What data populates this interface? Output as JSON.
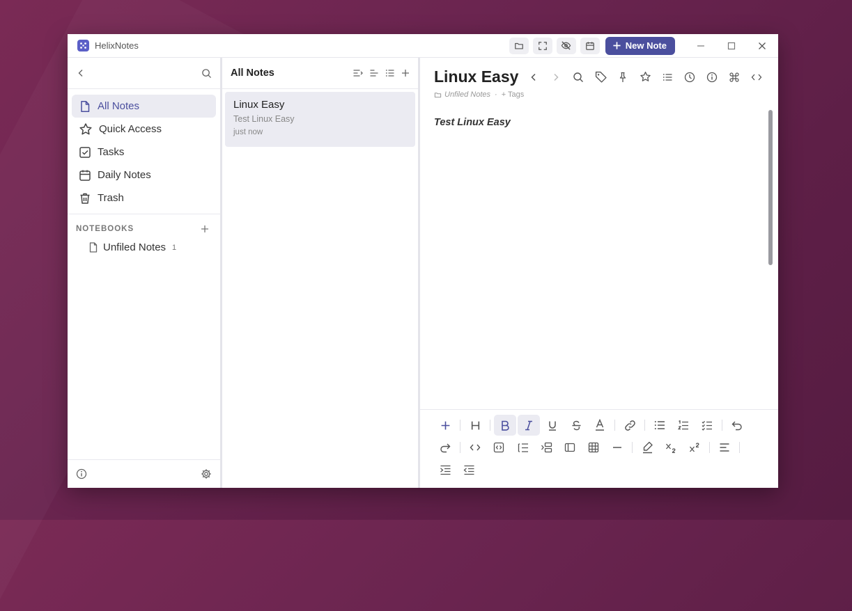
{
  "app": {
    "title": "HelixNotes",
    "new_note_label": "New Note"
  },
  "sidebar": {
    "items": [
      {
        "label": "All Notes",
        "icon": "file-icon",
        "active": true
      },
      {
        "label": "Quick Access",
        "icon": "star-icon"
      },
      {
        "label": "Tasks",
        "icon": "checkbox-icon"
      },
      {
        "label": "Daily Notes",
        "icon": "calendar-icon"
      },
      {
        "label": "Trash",
        "icon": "trash-icon"
      }
    ],
    "notebooks_title": "NOTEBOOKS",
    "notebooks": [
      {
        "label": "Unfiled Notes",
        "count": "1"
      }
    ]
  },
  "notelist": {
    "title": "All Notes",
    "notes": [
      {
        "title": "Linux Easy",
        "snippet": "Test Linux Easy",
        "time": "just now"
      }
    ]
  },
  "editor": {
    "title": "Linux Easy",
    "notebook": "Unfiled Notes",
    "separator": "·",
    "tags_label": "+ Tags",
    "body": "Test Linux Easy"
  },
  "colors": {
    "accent": "#4b4f9e",
    "selection": "#ebebf2",
    "desktop": "#6b2550"
  }
}
